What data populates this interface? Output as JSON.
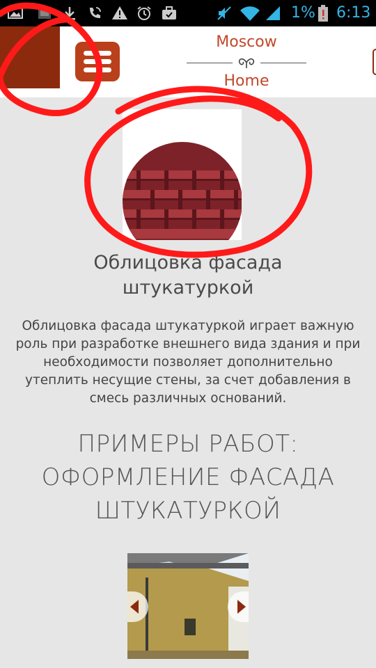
{
  "status_bar": {
    "battery_percent": "1%",
    "time": "6:13",
    "icons": [
      "image-icon",
      "app-icon",
      "download-icon",
      "wifi-call-icon",
      "warning-icon",
      "alarm-icon",
      "briefcase-icon",
      "mute-icon",
      "wifi-icon",
      "signal-icon",
      "battery-alert-icon"
    ]
  },
  "header": {
    "logo_top": "Moscow",
    "logo_bottom": "Home",
    "brand_color": "#8c2a0e",
    "menu_color": "#b9401a",
    "menu_icon": "hamburger-icon"
  },
  "service": {
    "title": "Облицовка фасада штукатуркой",
    "description": "Облицовка фасада штукатуркой играет важную роль при разработке внешнего вида здания и при необходимости позволяет дополнительно утеплить несущие стены, за счет добавления в смесь различных оснований.",
    "image_icon": "roof-tile-image"
  },
  "examples": {
    "title": "ПРИМЕРЫ РАБОТ: ОФОРМЛЕНИЕ ФАСАДА ШТУКАТУРКОЙ",
    "prev_icon": "chevron-left-icon",
    "next_icon": "chevron-right-icon",
    "arrow_color": "#8c2a0e"
  },
  "annotation_color": "#ff0000"
}
